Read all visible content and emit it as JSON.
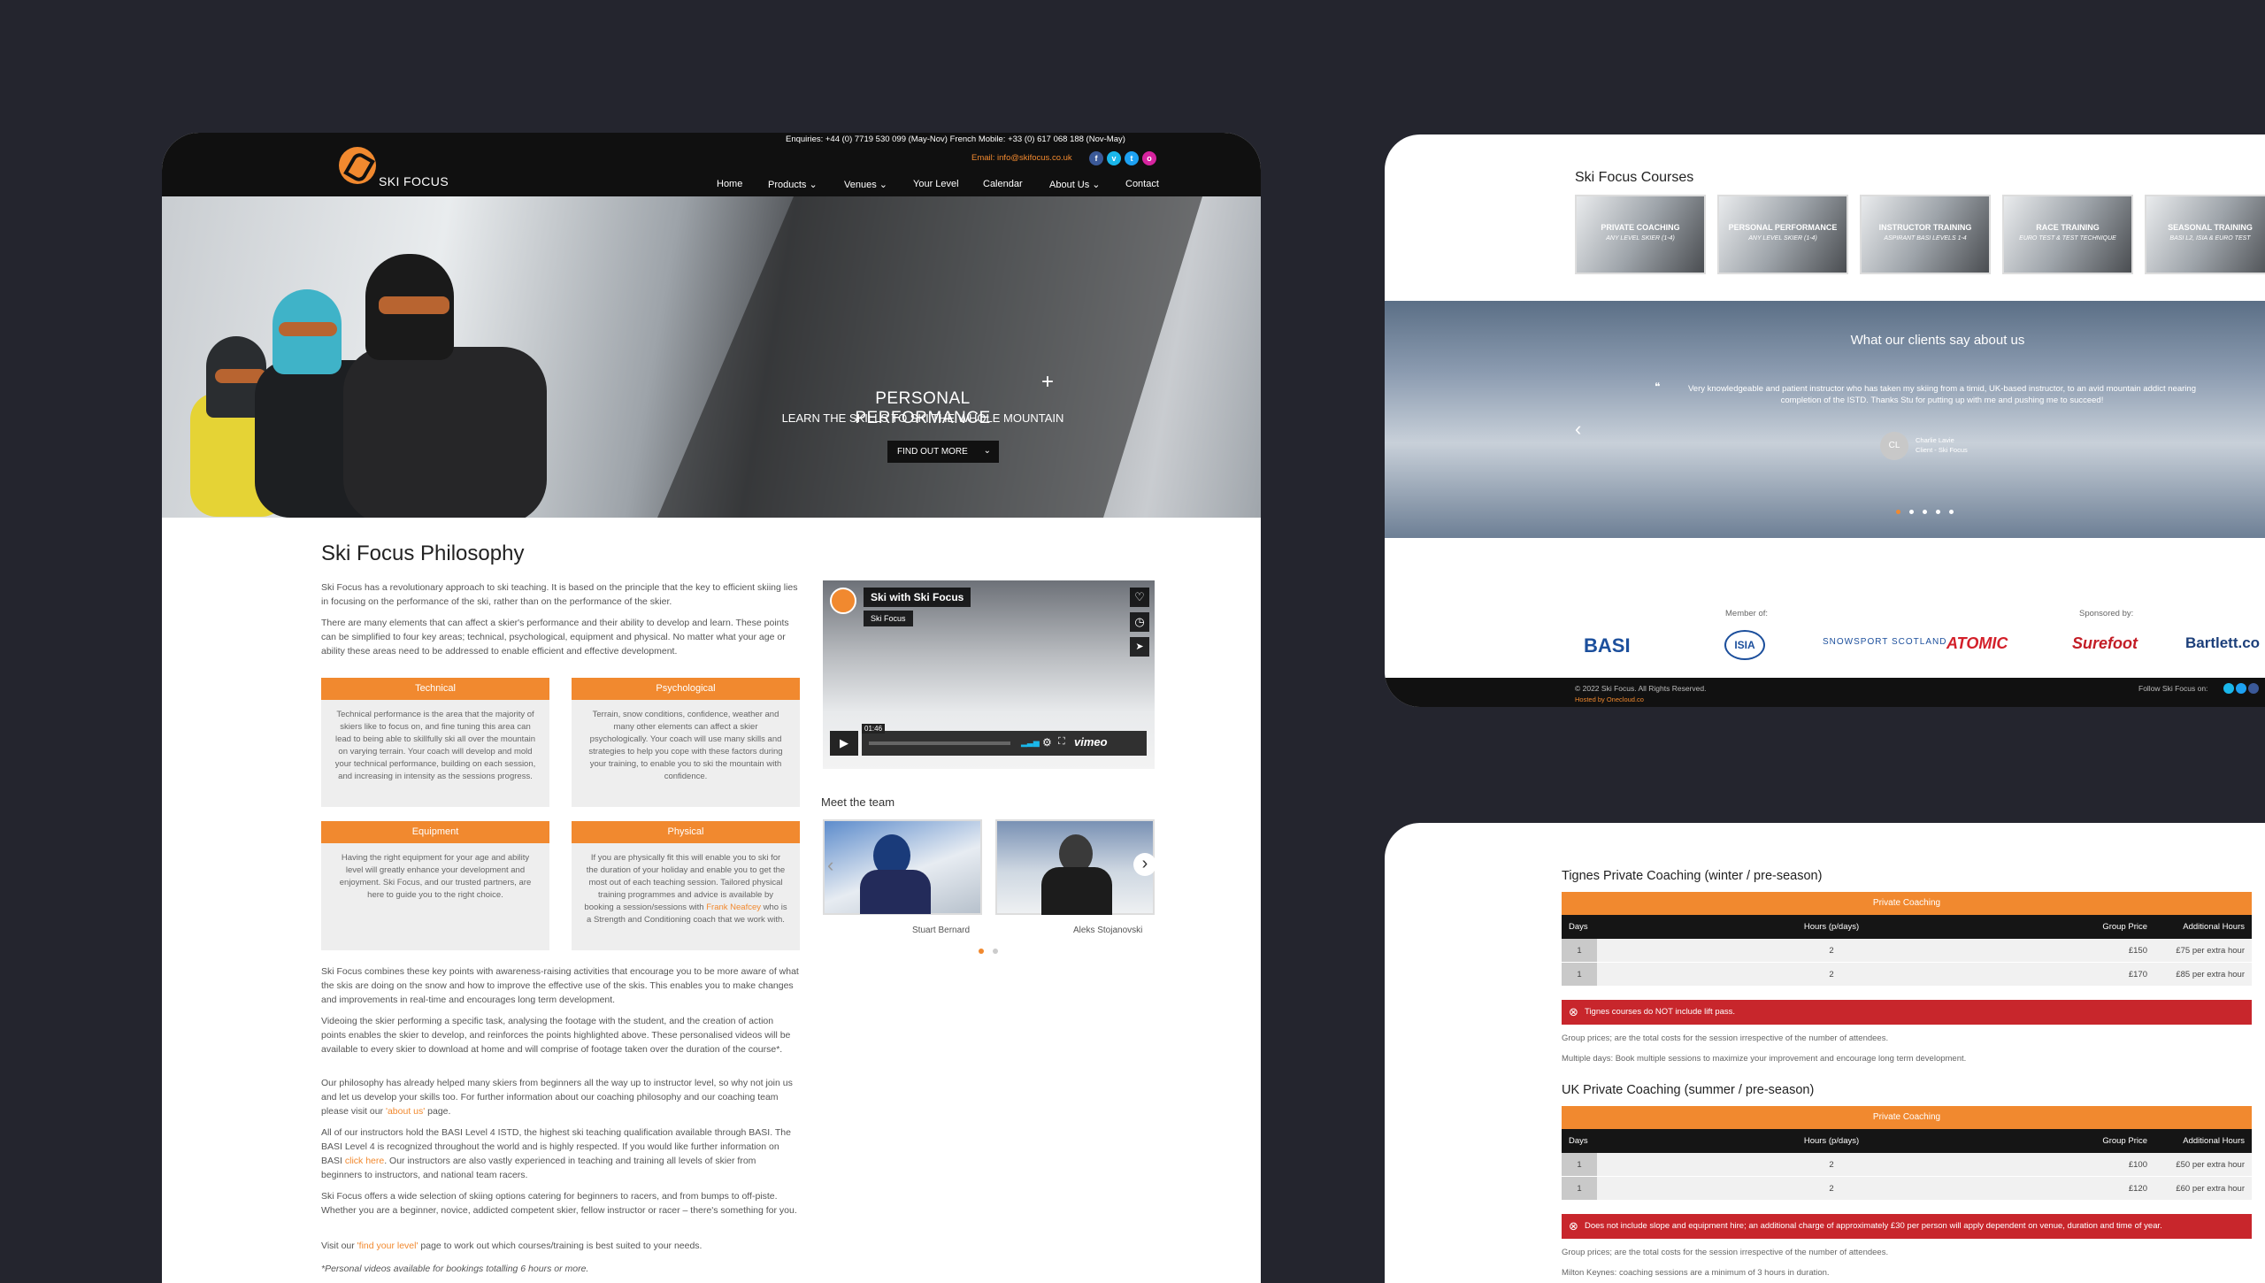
{
  "header": {
    "enquiries": "Enquiries: +44 (0) 7719 530 099 (May-Nov)  French Mobile: +33 (0) 617 068 188 (Nov-May)",
    "email": "Email: info@skifocus.co.uk",
    "logo_text": "SKI FOCUS",
    "nav": [
      "Home",
      "Products ⌄",
      "Venues ⌄",
      "Your Level",
      "Calendar",
      "About Us ⌄",
      "Contact"
    ]
  },
  "hero": {
    "title": "PERSONAL PERFORMANCE",
    "subtitle": "LEARN THE SKILLS TO SKI THE WHOLE MOUNTAIN",
    "button": "FIND OUT MORE",
    "button_chevron": "⌄",
    "cross": "+"
  },
  "philosophy": {
    "title": "Ski Focus Philosophy",
    "p1": "Ski Focus has a revolutionary approach to ski teaching. It is based on the principle that the key to efficient skiing lies in focusing on the performance of the ski, rather than on the performance of the skier.",
    "p2": "There are many elements that can affect a skier's performance and their ability to develop and learn. These points can be simplified to four key areas; technical, psychological, equipment and physical. No matter what your age or ability these areas need to be addressed to enable efficient and effective development.",
    "cards": [
      {
        "title": "Technical",
        "text": "Technical performance is the area that the majority of skiers like to focus on, and fine tuning this area can lead to being able to skillfully ski all over the mountain on varying terrain. Your coach will develop and mold your technical performance, building on each session, and increasing in intensity as the sessions progress."
      },
      {
        "title": "Psychological",
        "text": "Terrain, snow conditions, confidence, weather and many other elements can affect a skier psychologically. Your coach will use many skills and strategies to help you cope with these factors during your training, to enable you to ski the mountain with confidence."
      },
      {
        "title": "Equipment",
        "text": "Having the right equipment for your age and ability level will greatly enhance your development and enjoyment. Ski Focus, and our trusted partners, are here to guide you to the right choice."
      },
      {
        "title": "Physical",
        "text_a": "If you are physically fit this will enable you to ski for the duration of your holiday and enable you to get the most out of each teaching session. Tailored physical training programmes and advice is available by booking a session/sessions with ",
        "link": "Frank Neafcey",
        "text_b": " who is a Strength and Conditioning coach that we work with."
      }
    ],
    "p3": "Ski Focus combines these key points with awareness-raising activities that encourage you to be more aware of what the skis are doing on the snow and how to improve the effective use of the skis. This enables you to make changes and improvements in real-time and encourages long term development.",
    "p4": "Videoing the skier performing a specific task, analysing the footage with the student, and the creation of action points enables the skier to develop, and reinforces the points highlighted above. These personalised videos will be available to every skier to download at home and will comprise of footage taken over the duration of the course*.",
    "p5a": "Our philosophy has already helped many skiers from beginners all the way up to instructor level, so why not join us and let us develop your skills too. For further information about our coaching philosophy and our coaching team please visit our ",
    "p5link": "'about us'",
    "p5b": " page.",
    "p6a": "All of our instructors hold the BASI Level 4 ISTD, the highest ski teaching qualification available through BASI. The BASI Level 4 is recognized throughout the world and is highly respected. If you would like further information on BASI ",
    "p6link": "click here",
    "p6b": ". Our instructors are also vastly experienced in teaching and training all levels of skier from beginners to instructors, and national team racers.",
    "p7": "Ski Focus offers a wide selection of skiing options catering for beginners to racers, and from bumps to off-piste. Whether you are a beginner, novice, addicted competent skier, fellow instructor or racer – there's something for you.",
    "p8a": "Visit our ",
    "p8link": "'find your level'",
    "p8b": " page to work out which courses/training is best suited to your needs.",
    "p9": "*Personal videos available for bookings totalling 6 hours or more."
  },
  "video": {
    "title": "Ski with Ski Focus",
    "channel": "Ski Focus",
    "time": "01:46",
    "brand": "vimeo",
    "play": "▶",
    "heart": "♡",
    "clock": "◷",
    "send": "➤"
  },
  "team": {
    "title": "Meet the team",
    "members": [
      "Stuart Bernard",
      "Aleks Stojanovski"
    ],
    "prev": "‹",
    "next": "›"
  },
  "courses": {
    "title": "Ski Focus Courses",
    "items": [
      {
        "name": "PRIVATE COACHING",
        "sub": "ANY LEVEL SKIER (1-4)"
      },
      {
        "name": "PERSONAL PERFORMANCE",
        "sub": "ANY LEVEL SKIER (1-4)"
      },
      {
        "name": "INSTRUCTOR TRAINING",
        "sub": "ASPIRANT BASI LEVELS 1-4"
      },
      {
        "name": "RACE TRAINING",
        "sub": "EURO TEST & TEST TECHNIQUE"
      },
      {
        "name": "SEASONAL TRAINING",
        "sub": "BASI L2, ISIA & EURO TEST"
      }
    ]
  },
  "testimonials": {
    "title": "What our clients say about us",
    "quote": "Very knowledgeable and patient instructor who has taken my skiing from a timid, UK-based instructor, to an avid mountain addict nearing completion of the ISTD. Thanks Stu for putting up with me and pushing me to succeed!",
    "quote_mark": "❝",
    "initials": "CL",
    "name": "Charlie Lavie",
    "role": "Client - Ski Focus",
    "prev": "‹"
  },
  "partners": {
    "member_label": "Member of:",
    "sponsor_label": "Sponsored by:",
    "logos": [
      "BASI",
      "ISIA",
      "SNOWSPORT SCOTLAND",
      "ATOMIC",
      "Surefoot",
      "Bartlett.co"
    ]
  },
  "footer": {
    "copyright": "© 2022 Ski Focus.   All Rights Reserved.",
    "hosted": "Hosted by Onecloud.co",
    "follow": "Follow Ski Focus on:"
  },
  "pricing": {
    "tignes": {
      "title": "Tignes Private Coaching (winter / pre-season)",
      "table_title": "Private Coaching",
      "headers": [
        "Days",
        "Hours (p/days)",
        "Group Price",
        "Additional Hours"
      ],
      "rows": [
        [
          "1",
          "2",
          "£150",
          "£75 per extra hour"
        ],
        [
          "1",
          "2",
          "£170",
          "£85 per extra hour"
        ]
      ],
      "alert": "Tignes courses do NOT include lift pass.",
      "note1": "Group prices; are the total costs for the session irrespective of the number of attendees.",
      "note2": "Multiple days: Book multiple sessions to maximize your improvement and encourage long term development."
    },
    "uk": {
      "title": "UK Private Coaching (summer / pre-season)",
      "table_title": "Private Coaching",
      "headers": [
        "Days",
        "Hours (p/days)",
        "Group Price",
        "Additional Hours"
      ],
      "rows": [
        [
          "1",
          "2",
          "£100",
          "£50 per extra hour"
        ],
        [
          "1",
          "2",
          "£120",
          "£60 per extra hour"
        ]
      ],
      "alert": "Does not include slope and equipment hire; an additional charge of approximately £30 per person will apply dependent on venue, duration and time of year.",
      "note1": "Group prices; are the total costs for the session irrespective of the number of attendees.",
      "note2": "Milton Keynes: coaching sessions are a minimum of 3 hours in duration."
    }
  },
  "colors": {
    "accent": "#f1892f",
    "dark": "#101010",
    "background": "#24252e",
    "alert": "#c8262c"
  }
}
